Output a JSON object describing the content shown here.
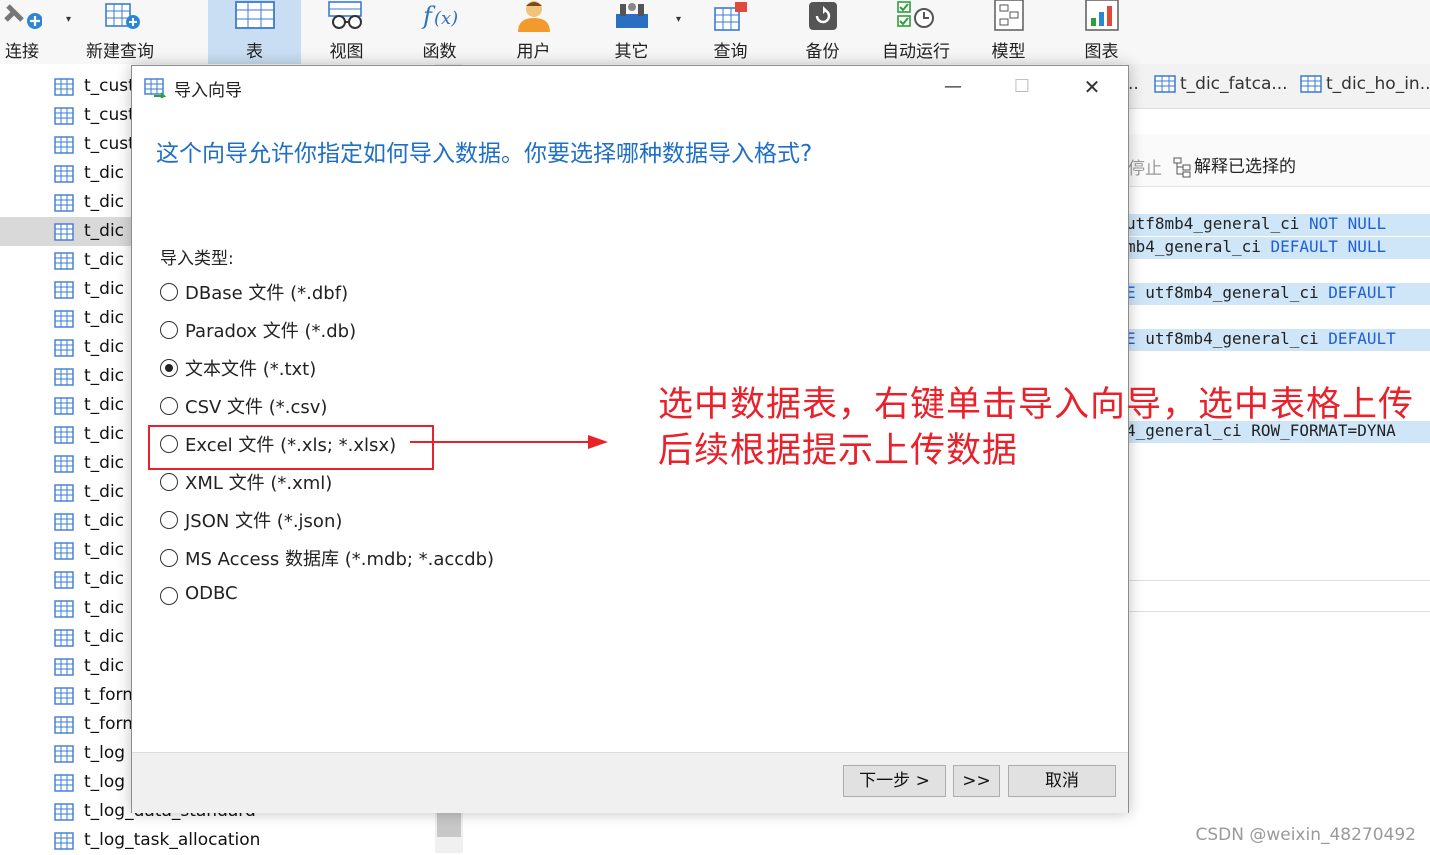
{
  "toolbar": {
    "items": [
      {
        "label": "连接",
        "icon": "plug-icon"
      },
      {
        "label": "新建查询",
        "icon": "new-query-icon"
      },
      {
        "label": "表",
        "icon": "table-icon"
      },
      {
        "label": "视图",
        "icon": "view-icon"
      },
      {
        "label": "函数",
        "icon": "function-icon",
        "glyph": "f(x)"
      },
      {
        "label": "用户",
        "icon": "user-icon"
      },
      {
        "label": "其它",
        "icon": "other-icon"
      },
      {
        "label": "查询",
        "icon": "query-icon"
      },
      {
        "label": "备份",
        "icon": "backup-icon"
      },
      {
        "label": "自动运行",
        "icon": "schedule-icon"
      },
      {
        "label": "模型",
        "icon": "model-icon"
      },
      {
        "label": "图表",
        "icon": "chart-icon"
      }
    ],
    "active_index": 2
  },
  "sidebar": {
    "items": [
      "t_cust",
      "t_cust",
      "t_cust",
      "t_dic",
      "t_dic",
      "t_dic",
      "t_dic",
      "t_dic",
      "t_dic",
      "t_dic",
      "t_dic",
      "t_dic",
      "t_dic",
      "t_dic",
      "t_dic",
      "t_dic",
      "t_dic",
      "t_dic",
      "t_dic",
      "t_dic",
      "t_dic",
      "t_form",
      "t_form",
      "t_log",
      "t_log",
      "t_log_data_standard",
      "t_log_task_allocation"
    ],
    "selected_index": 5
  },
  "editor": {
    "tab_overflow": "..",
    "tabs": [
      "t_dic_fatca...",
      "t_dic_ho_in..."
    ],
    "stop_label": "停止",
    "explain_label": "解释已选择的",
    "code_lines": [
      {
        "text": "utf8mb4_general_ci ",
        "kw": "NOT NULL"
      },
      {
        "text": "mb4_general_ci ",
        "kw": "DEFAULT NULL"
      },
      {
        "kw_pre": "E",
        "text": " utf8mb4_general_ci ",
        "kw": "DEFAULT"
      },
      {
        "kw_pre": "E",
        "text": " utf8mb4_general_ci ",
        "kw": "DEFAULT"
      },
      {
        "text": "4_general_ci ROW_FORMAT=DYNA",
        "kw": ""
      }
    ]
  },
  "dialog": {
    "title": "导入向导",
    "minimize": "—",
    "maximize": "☐",
    "close": "✕",
    "heading": "这个向导允许你指定如何导入数据。你要选择哪种数据导入格式?",
    "group_label": "导入类型:",
    "options": [
      "DBase 文件 (*.dbf)",
      "Paradox 文件 (*.db)",
      "文本文件 (*.txt)",
      "CSV 文件 (*.csv)",
      "Excel 文件 (*.xls; *.xlsx)",
      "XML 文件 (*.xml)",
      "JSON 文件 (*.json)",
      "MS Access 数据库 (*.mdb; *.accdb)",
      "ODBC"
    ],
    "selected_option": 2,
    "buttons": {
      "next": "下一步 >",
      "last": ">>",
      "cancel": "取消"
    }
  },
  "annotation": {
    "line1": "选中数据表，右键单击导入向导，选中表格上传",
    "line2": "后续根据提示上传数据",
    "color": "#e8212a"
  },
  "watermark": "CSDN @weixin_48270492"
}
